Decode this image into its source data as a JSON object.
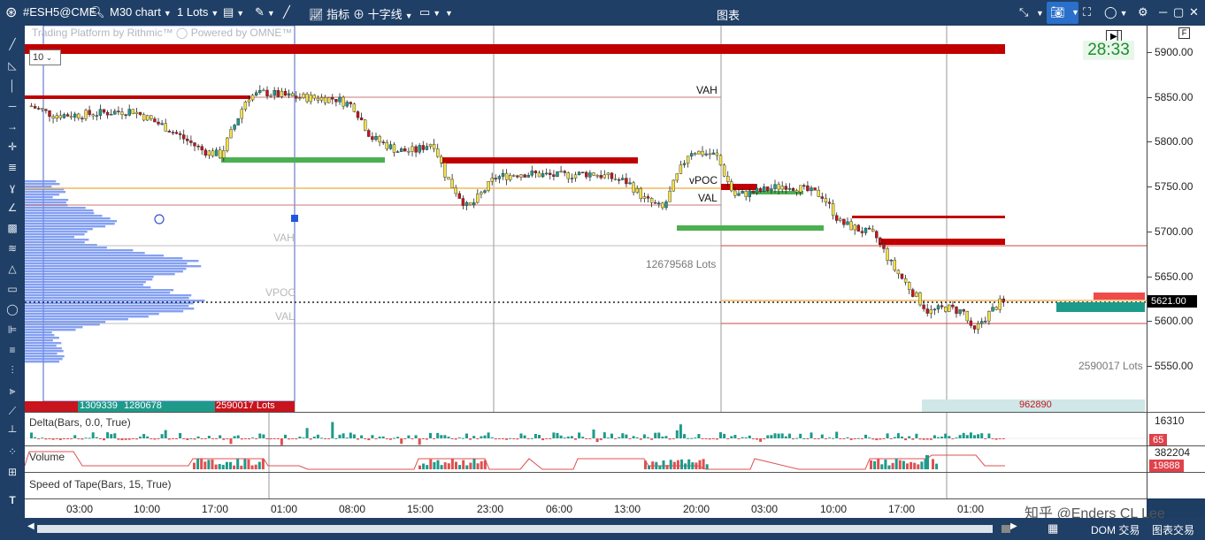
{
  "toolbar": {
    "symbol": "#ESH5@CME",
    "chart_type": "M30 chart",
    "lots": "1 Lots",
    "indicators": "指标",
    "crosshair": "十字线",
    "window_title": "图表"
  },
  "chart": {
    "watermark": "Trading Platform by Rithmic™  ◯ Powered by OMNE™",
    "interval_value": "10",
    "timer": "28:33",
    "f_button": "F",
    "y_labels": [
      "5900.00",
      "5850.00",
      "5800.00",
      "5750.00",
      "5700.00",
      "5650.00",
      "5600.00",
      "5550.00"
    ],
    "current_price": "5621.00",
    "x_labels": [
      "03:00",
      "10:00",
      "17:00",
      "01:00",
      "08:00",
      "15:00",
      "23:00",
      "06:00",
      "13:00",
      "20:00",
      "03:00",
      "10:00",
      "17:00",
      "01:00"
    ],
    "levels": {
      "vah1": "VAH",
      "vpoc1": "vPOC",
      "val1": "VAL",
      "vah2": "VAH",
      "vpoc2": "VPOC",
      "val2": "VAL"
    },
    "lots_label_1": "12679568 Lots",
    "lots_label_2": "2590017 Lots",
    "profile_footer": {
      "left": "1309339",
      "mid": "1280678",
      "right": "2590017 Lots"
    },
    "bottom_badge": "962890"
  },
  "delta": {
    "label": "Delta(Bars, 0.0, True)",
    "value_top": "16310",
    "value_badge": "65"
  },
  "volume": {
    "label": "Volume",
    "value_top": "382204",
    "value_badge": "19888"
  },
  "speed": {
    "label": "Speed of Tape(Bars, 15, True)"
  },
  "bottombar": {
    "dom": "DOM 交易",
    "chart_trade": "图表交易"
  },
  "overlay_text": "知乎 @Enders CL Lee",
  "colors": {
    "bull": "#1e9a8a",
    "bear": "#c8141c",
    "yellow": "#f2e14a",
    "green_level": "#4caf50",
    "red_level": "#c00000",
    "profile": "#6f8ff0"
  }
}
